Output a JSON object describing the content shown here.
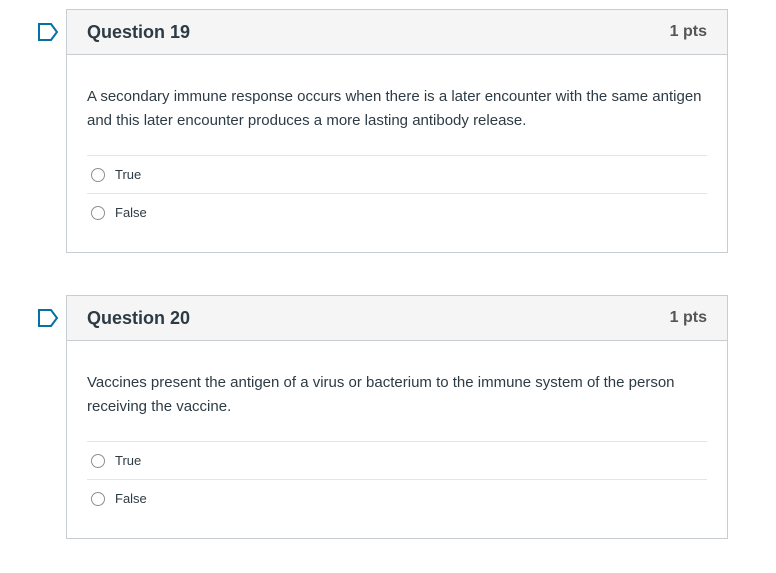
{
  "questions": [
    {
      "title": "Question 19",
      "points": "1 pts",
      "text": "A secondary immune response occurs when there is a later encounter with the same antigen and this later encounter produces a more lasting antibody release.",
      "answers": [
        "True",
        "False"
      ]
    },
    {
      "title": "Question 20",
      "points": "1 pts",
      "text": "Vaccines present the antigen of a virus or bacterium to the immune system of the person receiving the vaccine.",
      "answers": [
        "True",
        "False"
      ]
    }
  ],
  "colors": {
    "flag": "#0770a3",
    "header_bg": "#f5f5f5",
    "border": "#c7cdd1"
  }
}
